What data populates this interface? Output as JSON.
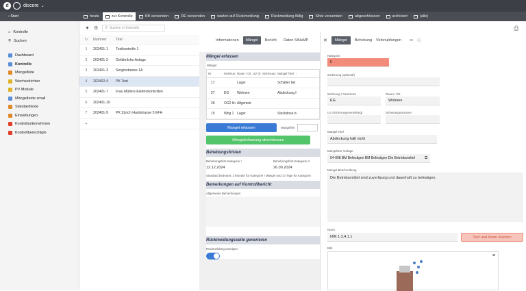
{
  "app": {
    "name": "discere"
  },
  "tabs": [
    {
      "label": "Start"
    },
    {
      "label": "heute"
    },
    {
      "label": "zur Kontrolle"
    },
    {
      "label": "KB versenden"
    },
    {
      "label": "RE versenden"
    },
    {
      "label": "warten auf Rückmeldung"
    },
    {
      "label": "Rückmeldung fällig"
    },
    {
      "label": "Sihie versenden"
    },
    {
      "label": "abgeschlossen"
    },
    {
      "label": "archiviert"
    },
    {
      "label": "(alle)"
    }
  ],
  "sidebar": {
    "top": [
      {
        "label": "Kontrolle"
      },
      {
        "label": "Suchen"
      }
    ],
    "items": [
      {
        "label": "Dashboard",
        "color": "#5a8fd8"
      },
      {
        "label": "Kontrolle",
        "color": "#5a8fd8"
      },
      {
        "label": "Mangelliste",
        "color": "#e08a2a"
      },
      {
        "label": "Wechselrichter",
        "color": "#e0b32a"
      },
      {
        "label": "PV Module",
        "color": "#e0b32a"
      },
      {
        "label": "Mängeltexte small",
        "color": "#5a8fd8"
      },
      {
        "label": "Standardtexte",
        "color": "#e08a2a"
      },
      {
        "label": "Einstellungen",
        "color": "#e08a2a"
      },
      {
        "label": "Kontrollunternehmen",
        "color": "#e0402a"
      },
      {
        "label": "Kontrollberechtigte",
        "color": "#e0402a"
      }
    ]
  },
  "list": {
    "search_placeholder": "Suchen in Kontrolle",
    "headers": {
      "num": "Nummer",
      "title": "Titel"
    },
    "rows": [
      {
        "i": "1",
        "n": "202401-1",
        "t": "Testkontrolle 1"
      },
      {
        "i": "2",
        "n": "202401-2",
        "t": "Gefährliche Anlage"
      },
      {
        "i": "3",
        "n": "202401-3",
        "t": "Sergiostrasse 1A"
      },
      {
        "i": "4",
        "n": "202402-4",
        "t": "PK Test"
      },
      {
        "i": "5",
        "n": "202401-7",
        "t": "Frau Müllers Elektrokontrollen"
      },
      {
        "i": "6",
        "n": "202401-10",
        "t": ""
      },
      {
        "i": "7",
        "n": "202401-9",
        "t": "PK Zürich Hardstrasse 5 EFH"
      }
    ],
    "add": "+"
  },
  "mid": {
    "tabs": [
      "Informationen",
      "Mängel",
      "Bericht",
      "Daten SiNaMP"
    ],
    "maengel_title": "Mängel erfassen",
    "maengel_label": "Mängel",
    "cols": [
      "Nr",
      "Wohnung",
      "Raum / Ort",
      "UV (Sich...",
      "Sicherung",
      "Mangel Titel"
    ],
    "rows": [
      [
        "17",
        "",
        "Lager",
        "",
        "",
        "Schalter bei St"
      ],
      [
        "27",
        "EG",
        "Wohnen",
        "",
        "",
        "Abdeckung hält"
      ],
      [
        "26",
        "OG2 links",
        "Allgemein",
        "",
        "",
        ""
      ],
      [
        "15",
        "Whg 1",
        "Lager",
        "",
        "",
        "Steckdose bei"
      ]
    ],
    "btn_erfassen": "Mangel erfassen",
    "mangelfrei": "Mangelfrei",
    "btn_abschliessen": "Mängelerfassung abschliessen",
    "fristen_title": "Behebungsfristen",
    "frist1_label": "Behebungsfrist Kategorie I",
    "frist1": "12.12.2024",
    "frist2_label": "Behebungsfrist Kategorie II",
    "frist2": "26.09.2024",
    "standard_text": "Standard bedeutet: 3 Monate für Kategorie I Mängel und 14 Tage für Kategorie",
    "bem_title": "Bemerkungen auf Kontrollbericht",
    "bem_label": "Allgemeine Bemerkungen",
    "rueck_title": "Rückmeldungsseite generieren",
    "rueck_label": "Rückmeldung anzeigen"
  },
  "right": {
    "tabs": [
      "Mängel",
      "Behebung",
      "Verknüpfungen"
    ],
    "kategorie_label": "Kategorie",
    "kategorie": "II",
    "sort_label": "Sortierung (optional)",
    "wohnung_label": "Wohnung / Geschoss",
    "wohnung": "EG",
    "raum_label": "Raum / Ort",
    "raum": "Wohnen",
    "uv_label": "UV (Sicherungsverteilung)",
    "sich_label": "Sicherungsnummer",
    "titel_label": "Mangel Titel",
    "titel": "Abdeckung hält nicht",
    "vorlage_label": "Mangeltext Vorlage",
    "vorlage": "04-008 BM Befestigen BM Befestigen Die Betriebsmittel",
    "beschr_label": "Mangel Beschreibung",
    "beschr": "Die Betriebsmittel sind zuverlässig und dauerhaft zu befestigen.",
    "norm_label": "Norm",
    "norm": "NIN 1.3.4.1.1",
    "btn_loeschen": "Text und Norm löschen",
    "bild_label": "Bild"
  },
  "colors": {
    "topbar": "#3c3f45",
    "primary": "#3a7bd5",
    "success": "#52c46a",
    "danger": "#f28b7a",
    "selected": "#dde6f3"
  }
}
